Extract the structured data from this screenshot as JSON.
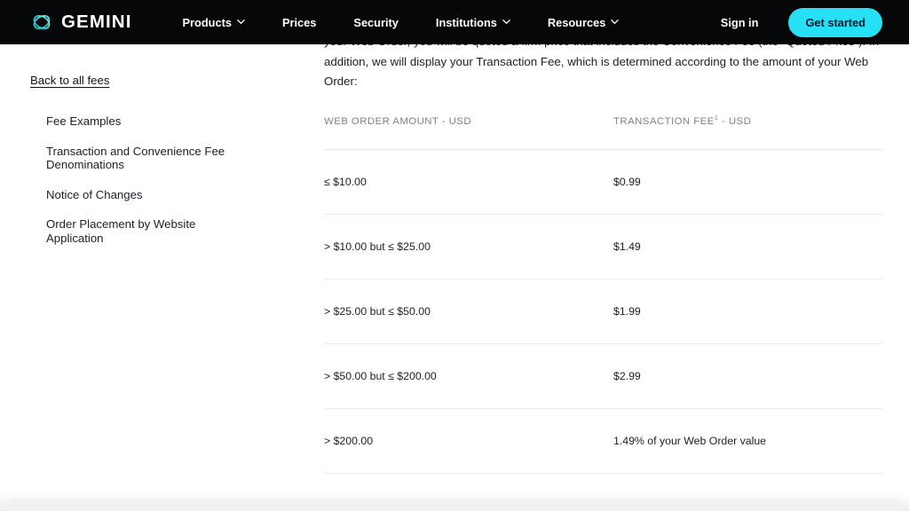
{
  "brand": {
    "name": "GEMINI",
    "logo_icon": "gemini-logo-icon",
    "logo_color": "#3CE0DC"
  },
  "nav": {
    "items": [
      {
        "label": "Products",
        "has_dropdown": true
      },
      {
        "label": "Prices",
        "has_dropdown": false
      },
      {
        "label": "Security",
        "has_dropdown": false
      },
      {
        "label": "Institutions",
        "has_dropdown": true
      },
      {
        "label": "Resources",
        "has_dropdown": true
      }
    ],
    "sign_in_label": "Sign in",
    "cta_label": "Get started",
    "cta_color": "#26E0F5",
    "bar_color": "#060709"
  },
  "sidebar": {
    "back_link": "Back to all fees",
    "items": [
      {
        "label": "Fee Examples"
      },
      {
        "label": "Transaction and Convenience Fee Denominations"
      },
      {
        "label": "Notice of Changes"
      },
      {
        "label": "Order Placement by Website Application"
      }
    ]
  },
  "article": {
    "intro": "your Web Order, you will be quoted a firm price that includes the Convenience Fee (the “Quoted Price”). In addition, we will display your Transaction Fee, which is determined according to the amount of your Web Order:",
    "table": {
      "columns": [
        {
          "label": "WEB ORDER AMOUNT - USD",
          "footnote": ""
        },
        {
          "label": "TRANSACTION FEE",
          "footnote": "1",
          "suffix": " - USD"
        }
      ],
      "rows": [
        {
          "amount": "≤ $10.00",
          "fee": "$0.99"
        },
        {
          "amount": "> $10.00 but ≤ $25.00",
          "fee": "$1.49"
        },
        {
          "amount": "> $25.00 but ≤ $50.00",
          "fee": "$1.99"
        },
        {
          "amount": "> $50.00 but ≤ $200.00",
          "fee": "$2.99"
        },
        {
          "amount": "> $200.00",
          "fee": "1.49% of your Web Order value"
        }
      ]
    }
  }
}
